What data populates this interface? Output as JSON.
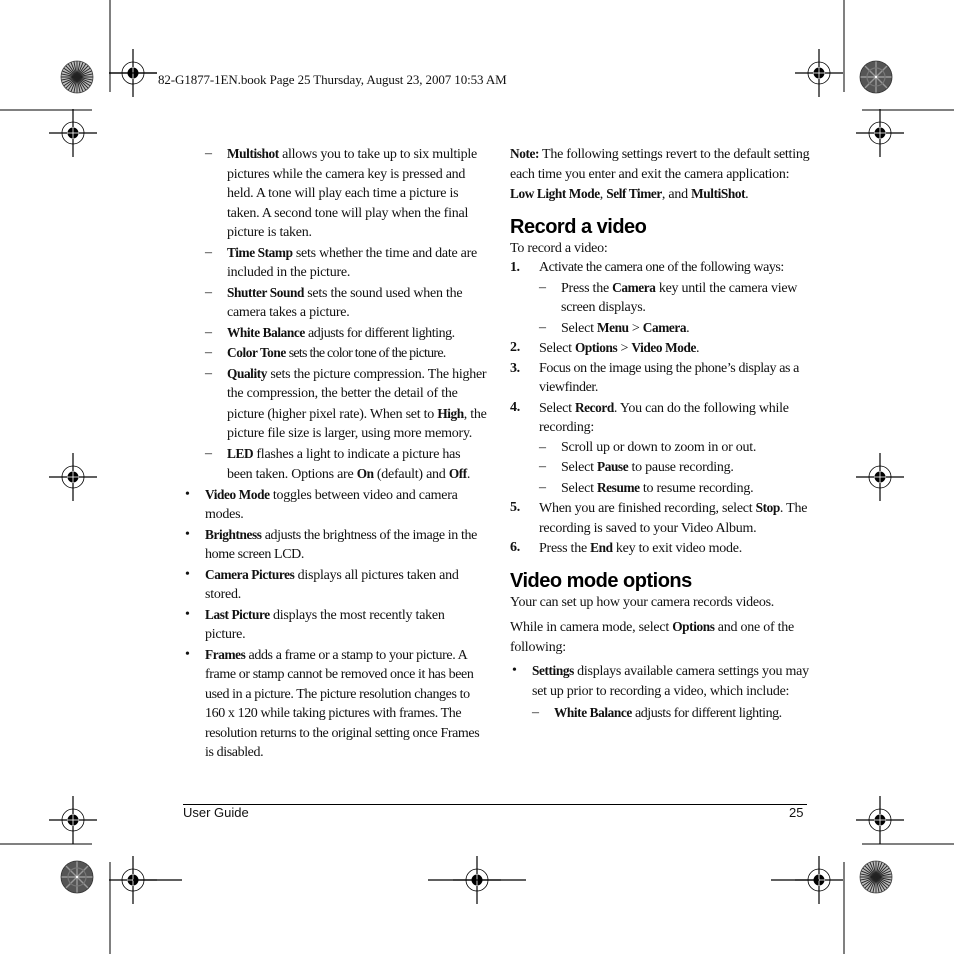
{
  "slug": "82-G1877-1EN.book  Page 25  Thursday, August 23, 2007  10:53 AM",
  "left_column": {
    "dash_items": [
      {
        "term": "Multishot",
        "text": " allows you to take up to six multiple pictures while the camera key is pressed and held. A tone will play each time a picture is taken. A second tone will play when the final picture is taken."
      },
      {
        "term": "Time Stamp",
        "text": " sets whether the time and date are included in the picture."
      },
      {
        "term": "Shutter Sound",
        "text": " sets the sound used when the camera takes a picture."
      },
      {
        "term": "White Balance",
        "text": " adjusts for different lighting."
      },
      {
        "term": "Color Tone",
        "text": " sets the color tone of the picture."
      },
      {
        "term": "Quality",
        "text": " sets the picture compression. The higher the compression, the better the detail of the picture (higher pixel rate). When set to ",
        "term2": "High",
        "text2": ", the picture file size is larger, using more memory."
      },
      {
        "term": "LED",
        "text": " flashes a light to indicate a picture has been taken. Options are ",
        "term2": "On",
        "text2": " (default) and ",
        "term3": "Off",
        "text3": "."
      }
    ],
    "bullet_items": [
      {
        "term": "Video Mode",
        "text": " toggles between video and camera modes."
      },
      {
        "term": "Brightness",
        "text": " adjusts the brightness of the image in the home screen LCD."
      },
      {
        "term": "Camera Pictures",
        "text": " displays all pictures taken and stored."
      },
      {
        "term": "Last Picture",
        "text": " displays the most recently taken picture."
      },
      {
        "term": "Frames",
        "text": " adds a frame or a stamp to your picture. A frame or stamp cannot be removed once it has been used in a picture. The picture resolution changes to 160 x 120 while taking pictures with frames. The resolution returns to the original setting once Frames is disabled."
      }
    ]
  },
  "right_column": {
    "note": {
      "label": "Note:",
      "text": " The following settings revert to the default setting each time you enter and exit the camera application: ",
      "term1": "Low Light Mode",
      "sep1": ", ",
      "term2": "Self Timer",
      "sep2": ", and ",
      "term3": "MultiShot",
      "end": "."
    },
    "record_heading": "Record a video",
    "record_intro": "To record a video:",
    "steps": [
      {
        "num": "1.",
        "text": "Activate the camera one of the following ways:"
      },
      {
        "num": "2.",
        "pre": "Select ",
        "term": "Options",
        "mid": " > ",
        "term2": "Video Mode",
        "end": "."
      },
      {
        "num": "3.",
        "text": "Focus on the image using the phone’s display as a viewfinder."
      },
      {
        "num": "4.",
        "pre": "Select ",
        "term": "Record",
        "end": ". You can do the following while recording:"
      },
      {
        "num": "5.",
        "pre": "When you are finished recording, select ",
        "term": "Stop",
        "end": ". The recording is saved to your Video Album."
      },
      {
        "num": "6.",
        "pre": "Press the ",
        "term": "End",
        "end": " key to exit video mode."
      }
    ],
    "step1_subs": [
      {
        "pre": "Press the ",
        "term": "Camera",
        "end": " key until the camera view screen displays."
      },
      {
        "pre": "Select ",
        "term": "Menu",
        "mid": " > ",
        "term2": "Camera",
        "end": "."
      }
    ],
    "step4_subs": [
      {
        "text": "Scroll up or down to zoom in or out."
      },
      {
        "pre": "Select ",
        "term": "Pause",
        "end": " to pause recording."
      },
      {
        "pre": "Select ",
        "term": "Resume",
        "end": " to resume recording."
      }
    ],
    "options_heading": "Video mode options",
    "options_intro": "Your can set up how your camera records videos.",
    "options_para": {
      "pre": "While in camera mode, select ",
      "term": "Options",
      "end": " and one of the following:"
    },
    "options_bullets": [
      {
        "term": "Settings",
        "text": " displays available camera settings you may set up prior to recording a video, which include:"
      }
    ],
    "settings_subs": [
      {
        "term": "White Balance",
        "text": " adjusts for different lighting."
      }
    ]
  },
  "markers": {
    "dash": "–",
    "bullet": "•"
  },
  "footer": {
    "left": "User Guide",
    "right": "25"
  }
}
